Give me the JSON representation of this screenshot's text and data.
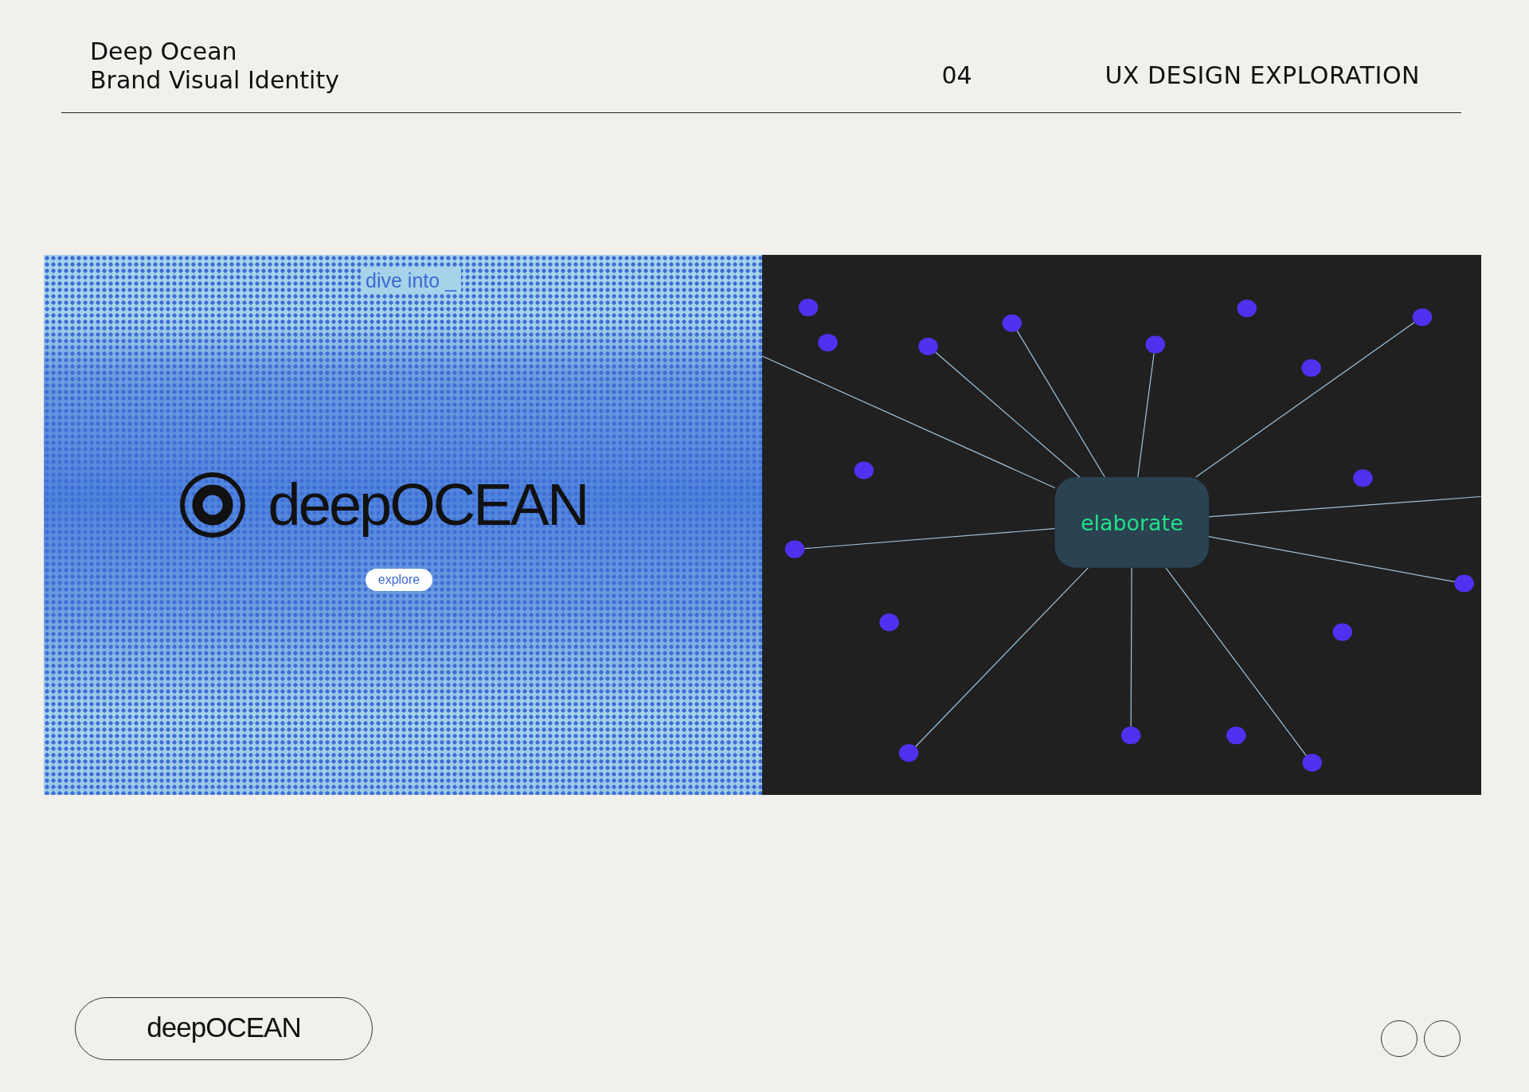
{
  "header": {
    "title_lines": [
      "Deep Ocean",
      "Brand Visual Identity"
    ],
    "page_number": "04",
    "section": "UX DESIGN EXPLORATION"
  },
  "landing_screen": {
    "tagline": "dive into _",
    "logo_text": "deepOCEAN",
    "button": "explore"
  },
  "graph_screen": {
    "center_label": "elaborate",
    "nodes": [
      {
        "kind": "dot",
        "linked": false
      },
      {
        "kind": "dot",
        "linked": false
      },
      {
        "kind": "dot",
        "linked": true
      },
      {
        "kind": "dot",
        "linked": true
      },
      {
        "kind": "dot",
        "linked": true
      },
      {
        "kind": "dot",
        "linked": false
      },
      {
        "kind": "dot",
        "linked": false
      },
      {
        "kind": "dot",
        "linked": true
      },
      {
        "kind": "dot",
        "linked": false
      },
      {
        "kind": "dot",
        "linked": false
      },
      {
        "kind": "dot",
        "linked": true
      },
      {
        "kind": "dot",
        "linked": true
      },
      {
        "kind": "dot",
        "linked": false
      },
      {
        "kind": "dot",
        "linked": false
      },
      {
        "kind": "dot",
        "linked": true
      },
      {
        "kind": "dot",
        "linked": true
      },
      {
        "kind": "dot",
        "linked": false
      },
      {
        "kind": "dot",
        "linked": true
      },
      {
        "kind": "edge"
      },
      {
        "kind": "edge"
      }
    ]
  },
  "footer": {
    "brand": "deepOCEAN"
  }
}
